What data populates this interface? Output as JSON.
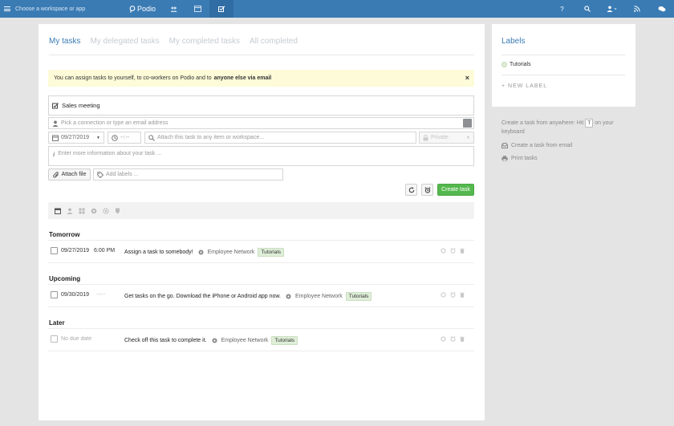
{
  "topbar": {
    "workspace_label": "Choose a workspace or app",
    "logo_text": "Podio",
    "help_label": "?"
  },
  "tabs": [
    {
      "label": "My tasks",
      "active": true
    },
    {
      "label": "My delegated tasks",
      "active": false
    },
    {
      "label": "My completed tasks",
      "active": false
    },
    {
      "label": "All completed",
      "active": false
    }
  ],
  "notice": {
    "text": "You can assign tasks to yourself, to co-workers on Podio and to",
    "bold": "anyone else via email",
    "close": "×"
  },
  "form": {
    "title_value": "Sales meeting",
    "person_placeholder": "Pick a connection or type an email address",
    "date_value": "09/27/2019",
    "time_placeholder": "--:--",
    "attach_placeholder": "Attach this task to any item or workspace...",
    "private_label": "Private",
    "info_placeholder": "Enter more information about your task ...",
    "attach_file_label": "Attach file",
    "labels_placeholder": "Add labels ...",
    "create_label": "Create task"
  },
  "sections": [
    {
      "heading": "Tomorrow",
      "tasks": [
        {
          "date": "09/27/2019",
          "time": "6:00 PM",
          "title": "Assign a task to somebody!",
          "workspace": "Employee Network",
          "tag": "Tutorials"
        }
      ]
    },
    {
      "heading": "Upcoming",
      "tasks": [
        {
          "date": "09/30/2019",
          "time": "--:--",
          "title": "Get tasks on the go. Download the iPhone or Android app now.",
          "workspace": "Employee Network",
          "tag": "Tutorials"
        }
      ]
    },
    {
      "heading": "Later",
      "tasks": [
        {
          "date": "No due date",
          "time": "",
          "title": "Check off this task to complete it.",
          "workspace": "Employee Network",
          "tag": "Tutorials"
        }
      ]
    }
  ],
  "sidebar": {
    "title": "Labels",
    "labels": [
      {
        "name": "Tutorials"
      }
    ],
    "new_label": "+ NEW LABEL",
    "tip_before": "Create a task from anywhere: Hit",
    "tip_key": "T",
    "tip_after": "on your keyboard",
    "email_link": "Create a task from email",
    "print_link": "Print tasks"
  },
  "colors": {
    "brand": "#3a7bb4",
    "create_button": "#55b84e",
    "notice_bg": "#fdfbd8",
    "tag_bg": "#dfeed8"
  }
}
